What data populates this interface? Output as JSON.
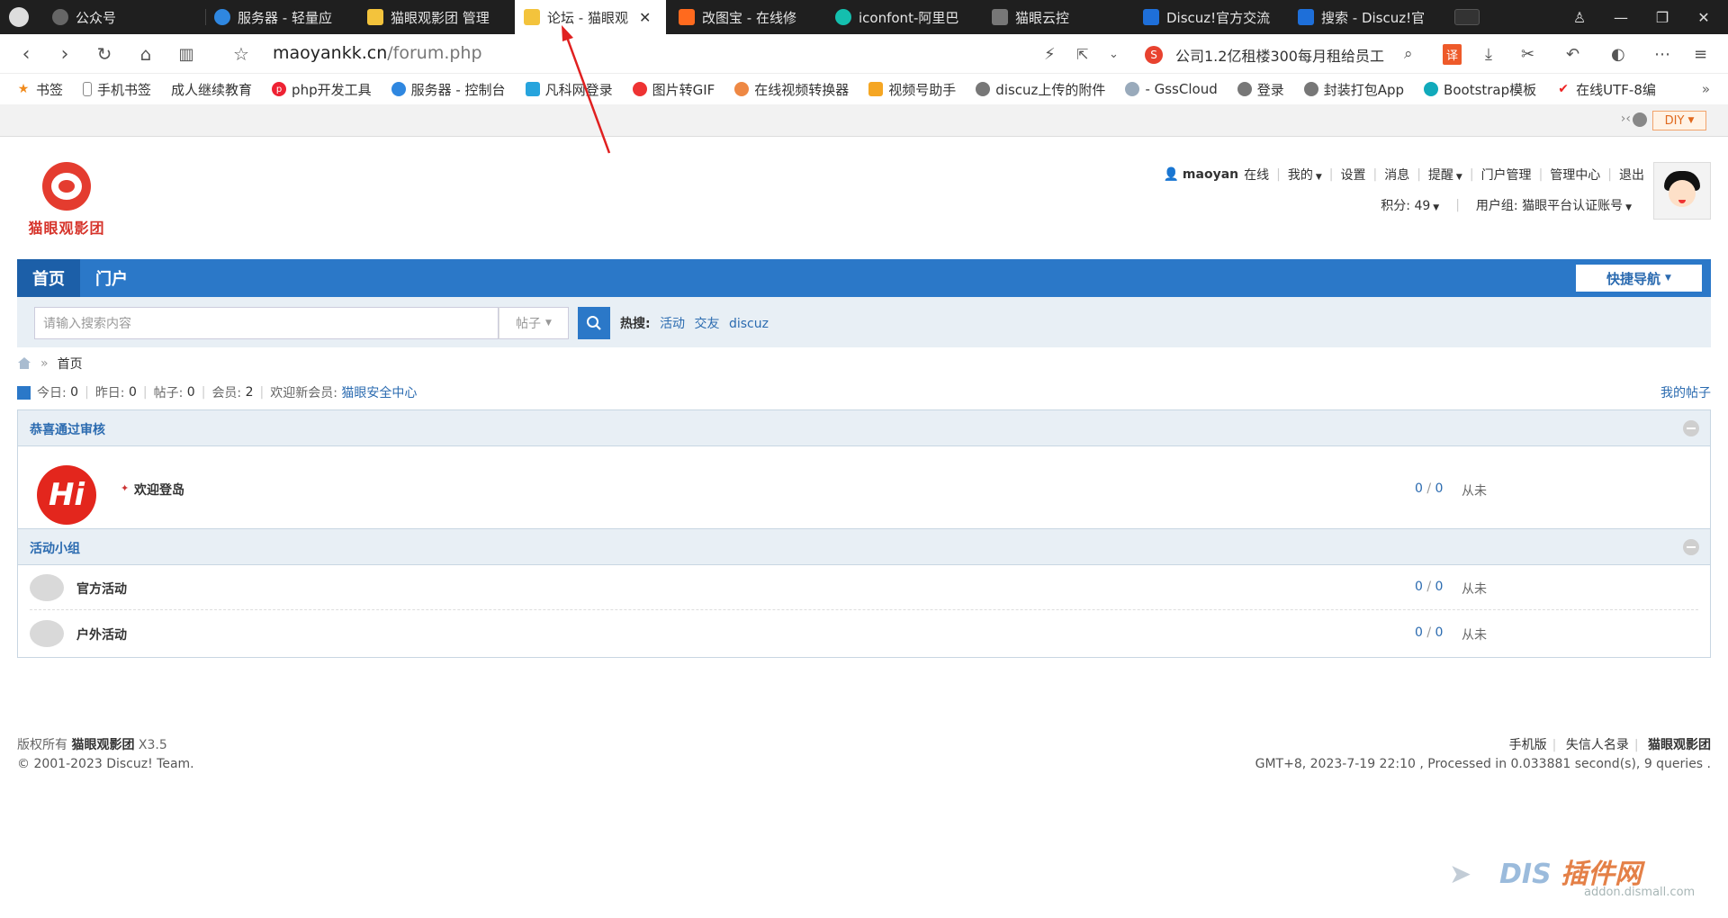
{
  "tabs": [
    {
      "label": "公众号",
      "color": "#555"
    },
    {
      "label": "服务器 - 轻量应",
      "color": "#2f87e0"
    },
    {
      "label": "猫眼观影团 管理",
      "color": "#f3c33c"
    },
    {
      "label": "论坛 - 猫眼观",
      "color": "#f3c33c"
    },
    {
      "label": "改图宝 - 在线修",
      "color": "#ff6a1e"
    },
    {
      "label": "iconfont-阿里巴",
      "color": "#14bfae"
    },
    {
      "label": "猫眼云控",
      "color": "#666"
    },
    {
      "label": "Discuz!官方交流",
      "color": "#1e6fd9"
    },
    {
      "label": "搜索 - Discuz!官",
      "color": "#1e6fd9"
    }
  ],
  "address": {
    "host": "maoyankk.cn",
    "path": "/forum.php",
    "news": "公司1.2亿租楼300每月租给员工"
  },
  "bookmarks": [
    {
      "label": "书签",
      "color": "#f08a1c"
    },
    {
      "label": "手机书签",
      "color": "#888"
    },
    {
      "label": "成人继续教育",
      "color": "#bbb"
    },
    {
      "label": "php开发工具",
      "color": "#e23"
    },
    {
      "label": "服务器 - 控制台",
      "color": "#2f87e0"
    },
    {
      "label": "凡科网登录",
      "color": "#27a4dd"
    },
    {
      "label": "图片转GIF",
      "color": "#e33"
    },
    {
      "label": "在线视频转换器",
      "color": "#e84"
    },
    {
      "label": "视频号助手",
      "color": "#f5a623"
    },
    {
      "label": "discuz上传的附件",
      "color": "#777"
    },
    {
      "label": "- GssCloud",
      "color": "#9ab"
    },
    {
      "label": "登录",
      "color": "#777"
    },
    {
      "label": "封装打包App",
      "color": "#777"
    },
    {
      "label": "Bootstrap模板",
      "color": "#1ab"
    },
    {
      "label": "在线UTF-8编",
      "color": "#e22"
    }
  ],
  "diy_label": "DIY",
  "site": {
    "logo_text": "猫眼观影团"
  },
  "user": {
    "name": "maoyan",
    "status": "在线",
    "links": [
      "我的",
      "设置",
      "消息",
      "提醒",
      "门户管理",
      "管理中心",
      "退出"
    ],
    "credits": "积分: 49",
    "group": "用户组: 猫眼平台认证账号"
  },
  "nav": {
    "items": [
      "首页",
      "门户"
    ],
    "quick": "快捷导航"
  },
  "search": {
    "placeholder": "请输入搜索内容",
    "type": "帖子",
    "hot_label": "热搜:",
    "hot": [
      "活动",
      "交友",
      "discuz"
    ]
  },
  "breadcrumb": {
    "current": "首页"
  },
  "stats": {
    "today_label": "今日:",
    "today": "0",
    "yesterday_label": "昨日:",
    "yesterday": "0",
    "posts_label": "帖子:",
    "posts": "0",
    "members_label": "会员:",
    "members": "2",
    "newmember_label": "欢迎新会员:",
    "newmember": "猫眼安全中心",
    "my_posts": "我的帖子"
  },
  "categories": [
    {
      "title": "恭喜通过审核",
      "forums": [
        {
          "name": "欢迎登岛",
          "threads": "0",
          "posts": "0",
          "last": "从未"
        }
      ]
    },
    {
      "title": "活动小组",
      "forums": [
        {
          "name": "官方活动",
          "threads": "0",
          "posts": "0",
          "last": "从未"
        },
        {
          "name": "户外活动",
          "threads": "0",
          "posts": "0",
          "last": "从未"
        }
      ]
    }
  ],
  "badge_text": "Hi",
  "footer": {
    "copyright_prefix": "版权所有",
    "site": "猫眼观影团",
    "version": "X3.5",
    "team": "© 2001-2023 Discuz! Team.",
    "links": [
      "手机版",
      "失信人名录",
      "猫眼观影团"
    ],
    "runtime": "GMT+8, 2023-7-19 22:10 , Processed in 0.033881 second(s), 9 queries ."
  },
  "watermark": {
    "brand_a": "DIS",
    "brand_b": "插件网",
    "domain": "addon.dismall.com"
  }
}
